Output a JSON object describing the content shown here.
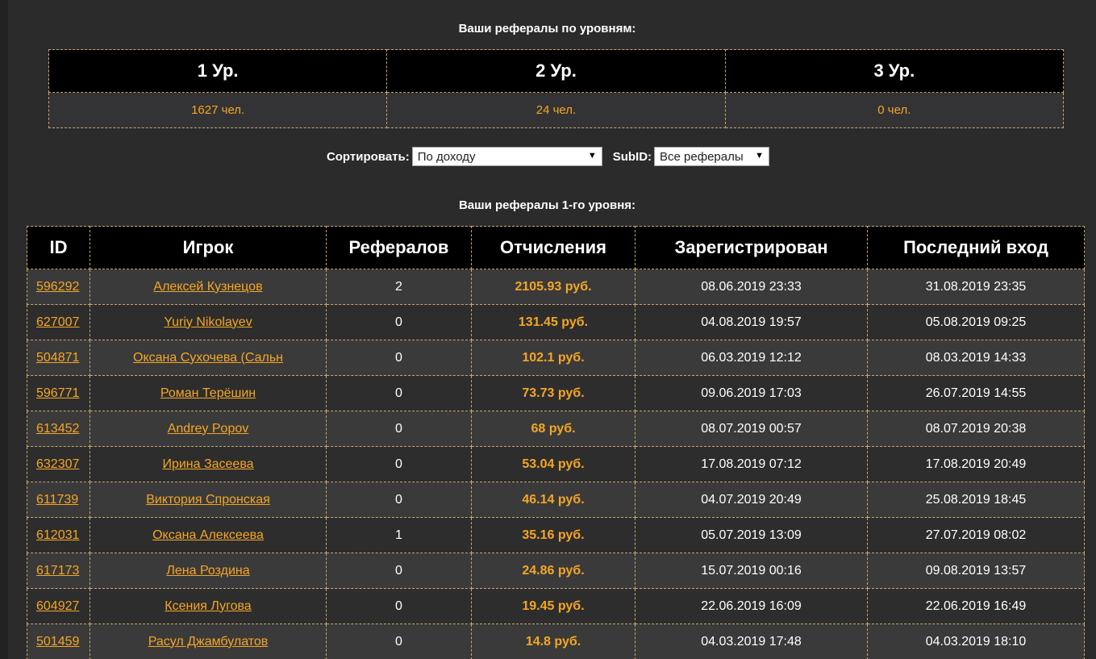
{
  "levels": {
    "title": "Ваши рефералы по уровням:",
    "headers": [
      "1 Ур.",
      "2 Ур.",
      "3 Ур."
    ],
    "counts": [
      "1627 чел.",
      "24 чел.",
      "0 чел."
    ]
  },
  "filters": {
    "sort_label": "Сортировать:",
    "sort_value": "По доходу",
    "subid_label": "SubID:",
    "subid_value": "Все рефералы"
  },
  "referrals": {
    "title": "Ваши рефералы 1-го уровня:",
    "columns": [
      "ID",
      "Игрок",
      "Рефералов",
      "Отчисления",
      "Зарегистрирован",
      "Последний вход"
    ],
    "rows": [
      {
        "id": "596292",
        "player": "Алексей Кузнецов",
        "refs": "2",
        "earn": "2105.93 руб.",
        "registered": "08.06.2019 23:33",
        "last": "31.08.2019 23:35"
      },
      {
        "id": "627007",
        "player": "Yuriy Nikolayev",
        "refs": "0",
        "earn": "131.45 руб.",
        "registered": "04.08.2019 19:57",
        "last": "05.08.2019 09:25"
      },
      {
        "id": "504871",
        "player": "Оксана Сухочева (Сальн",
        "refs": "0",
        "earn": "102.1 руб.",
        "registered": "06.03.2019 12:12",
        "last": "08.03.2019 14:33"
      },
      {
        "id": "596771",
        "player": "Роман Терёшин",
        "refs": "0",
        "earn": "73.73 руб.",
        "registered": "09.06.2019 17:03",
        "last": "26.07.2019 14:55"
      },
      {
        "id": "613452",
        "player": "Andrey Popov",
        "refs": "0",
        "earn": "68 руб.",
        "registered": "08.07.2019 00:57",
        "last": "08.07.2019 20:38"
      },
      {
        "id": "632307",
        "player": "Ирина Засеева",
        "refs": "0",
        "earn": "53.04 руб.",
        "registered": "17.08.2019 07:12",
        "last": "17.08.2019 20:49"
      },
      {
        "id": "611739",
        "player": "Виктория Спронская",
        "refs": "0",
        "earn": "46.14 руб.",
        "registered": "04.07.2019 20:49",
        "last": "25.08.2019 18:45"
      },
      {
        "id": "612031",
        "player": "Оксана Алексеева",
        "refs": "1",
        "earn": "35.16 руб.",
        "registered": "05.07.2019 13:09",
        "last": "27.07.2019 08:02"
      },
      {
        "id": "617173",
        "player": "Лена Роздина",
        "refs": "0",
        "earn": "24.86 руб.",
        "registered": "15.07.2019 00:16",
        "last": "09.08.2019 13:57"
      },
      {
        "id": "604927",
        "player": "Ксения Лугова",
        "refs": "0",
        "earn": "19.45 руб.",
        "registered": "22.06.2019 16:09",
        "last": "22.06.2019 16:49"
      },
      {
        "id": "501459",
        "player": "Расул Джамбулатов",
        "refs": "0",
        "earn": "14.8 руб.",
        "registered": "04.03.2019 17:48",
        "last": "04.03.2019 18:10"
      }
    ]
  },
  "colors": {
    "accent": "#f5a623",
    "header_bg": "#000000",
    "border": "#c9a86a"
  }
}
